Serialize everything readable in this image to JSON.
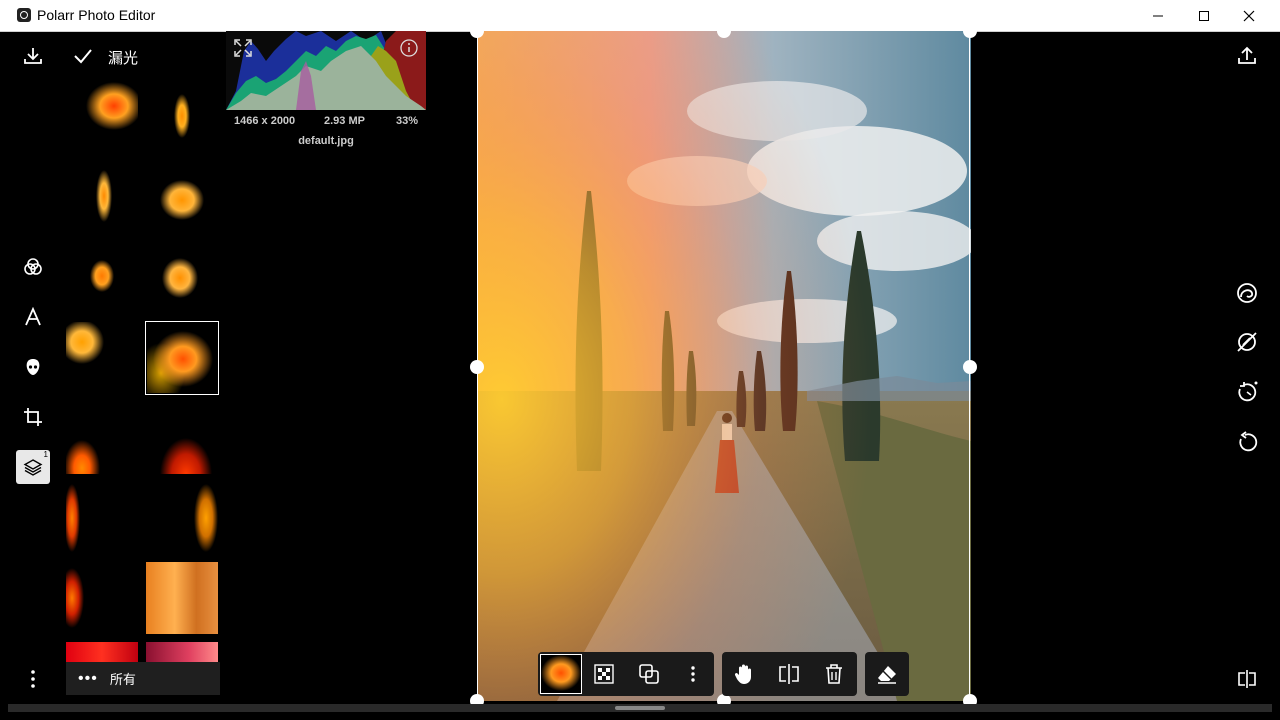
{
  "window": {
    "title": "Polarr Photo Editor",
    "minimize_icon": "minimize-icon",
    "maximize_icon": "maximize-icon",
    "close_icon": "close-icon"
  },
  "header": {
    "download_icon": "download-icon",
    "confirm_icon": "check-icon",
    "mode_label": "漏光",
    "expand_icon": "expand-icon",
    "info_icon": "info-icon",
    "export_icon": "share-upload-icon"
  },
  "histogram": {
    "dimensions": "1466 x 2000",
    "megapixels": "2.93 MP",
    "zoom": "33%",
    "filename": "default.jpg"
  },
  "left_toolbar": {
    "items": [
      {
        "name": "filters-icon"
      },
      {
        "name": "text-icon"
      },
      {
        "name": "face-icon"
      },
      {
        "name": "crop-icon"
      },
      {
        "name": "layers-icon",
        "active": true,
        "badge": "1"
      }
    ],
    "more_icon": "more-vertical-icon"
  },
  "overlay_library": {
    "thumbnails": [
      "light-leak-1",
      "light-leak-2",
      "light-leak-3",
      "light-leak-4",
      "light-leak-5",
      "light-leak-6",
      "light-leak-7",
      "light-leak-8",
      "light-leak-9",
      "light-leak-10",
      "light-leak-11",
      "light-leak-12",
      "light-leak-13",
      "light-leak-14",
      "light-leak-15",
      "light-leak-16"
    ],
    "selected_index": 7,
    "filter_label": "所有"
  },
  "right_toolbar": {
    "items": [
      "spiral-icon",
      "erase-slash-icon",
      "timer-rotate-icon",
      "rotate-icon",
      "compare-icon"
    ]
  },
  "bottom_toolbar": {
    "group1": [
      "overlay-thumbnail",
      "transparency-icon",
      "blend-mode-icon",
      "more-vertical-icon"
    ],
    "group2": [
      "hand-icon",
      "flip-icon",
      "trash-icon"
    ],
    "group3": [
      "eraser-icon"
    ]
  },
  "colors": {
    "background": "#000000",
    "titlebar": "#ffffff",
    "panel": "#1a1a1a",
    "accent": "#ffffff"
  }
}
